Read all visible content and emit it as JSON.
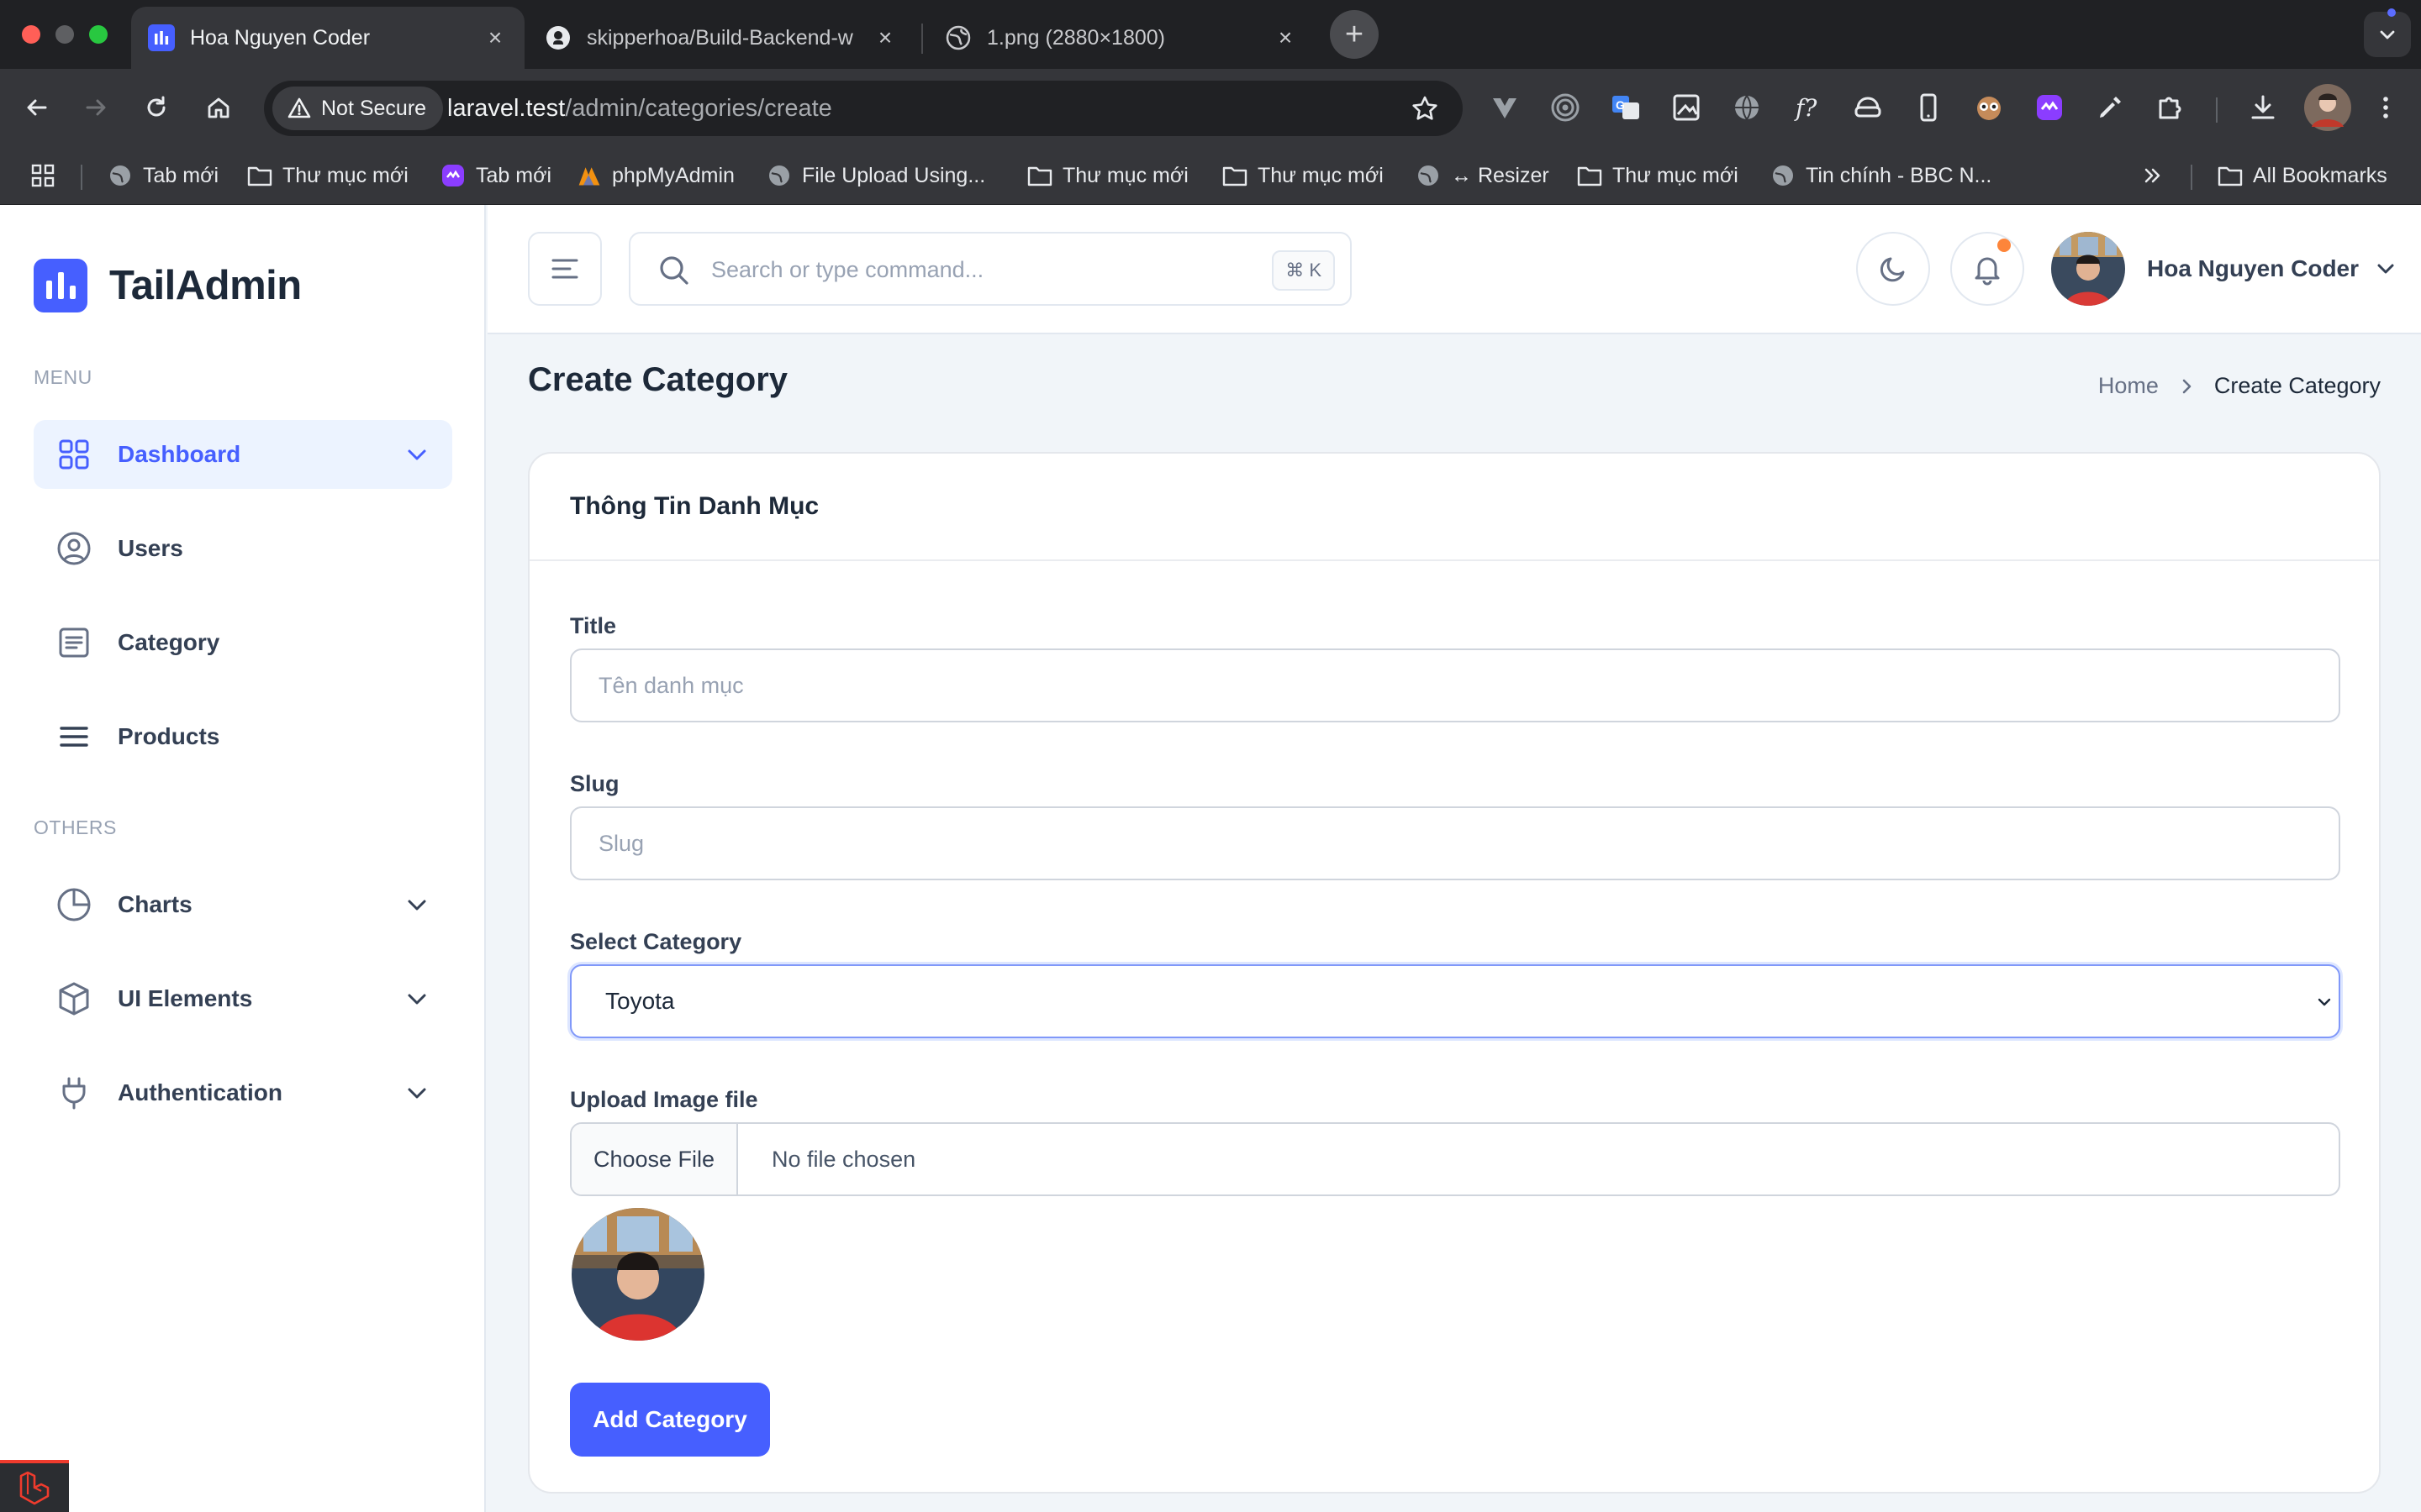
{
  "browser": {
    "tabs": [
      {
        "title": "Hoa Nguyen Coder",
        "icon": "tailadmin-favicon",
        "active": true
      },
      {
        "title": "skipperhoa/Build-Backend-w",
        "icon": "github-icon",
        "active": false
      },
      {
        "title": "1.png (2880×1800)",
        "icon": "globe-icon",
        "active": false
      }
    ],
    "security_label": "Not Secure",
    "url_host": "laravel.test",
    "url_path": "/admin/categories/create",
    "bookmarks": [
      {
        "label": "Tab mới",
        "icon": "globe-icon"
      },
      {
        "label": "Thư mục mới",
        "icon": "folder-icon"
      },
      {
        "label": "Tab mới",
        "icon": "purple-app-icon"
      },
      {
        "label": "phpMyAdmin",
        "icon": "phpmyadmin-icon"
      },
      {
        "label": "File Upload Using...",
        "icon": "globe-icon"
      },
      {
        "label": "Thư mục mới",
        "icon": "folder-icon"
      },
      {
        "label": "Thư mục mới",
        "icon": "folder-icon"
      },
      {
        "label": "↔ Resizer",
        "icon": "globe-icon"
      },
      {
        "label": "Thư mục mới",
        "icon": "folder-icon"
      },
      {
        "label": "Tin chính - BBC N...",
        "icon": "globe-icon"
      }
    ],
    "all_bookmarks_label": "All Bookmarks"
  },
  "sidebar": {
    "brand": "TailAdmin",
    "menu_heading": "MENU",
    "menu_items": [
      {
        "label": "Dashboard",
        "icon": "grid-icon",
        "active": true,
        "has_children": true
      },
      {
        "label": "Users",
        "icon": "user-circle-icon",
        "active": false,
        "has_children": false
      },
      {
        "label": "Category",
        "icon": "list-icon",
        "active": false,
        "has_children": false
      },
      {
        "label": "Products",
        "icon": "bars-icon",
        "active": false,
        "has_children": false
      }
    ],
    "others_heading": "OTHERS",
    "other_items": [
      {
        "label": "Charts",
        "icon": "pie-chart-icon",
        "has_children": true
      },
      {
        "label": "UI Elements",
        "icon": "box-icon",
        "has_children": true
      },
      {
        "label": "Authentication",
        "icon": "plug-icon",
        "has_children": true
      }
    ]
  },
  "header": {
    "search_placeholder": "Search or type command...",
    "search_shortcut": "⌘ K",
    "user_name": "Hoa Nguyen Coder"
  },
  "page": {
    "title": "Create Category",
    "breadcrumb_home": "Home",
    "breadcrumb_current": "Create Category"
  },
  "form": {
    "card_title": "Thông Tin Danh Mục",
    "title_label": "Title",
    "title_placeholder": "Tên danh mục",
    "slug_label": "Slug",
    "slug_placeholder": "Slug",
    "select_label": "Select Category",
    "select_value": "Toyota",
    "upload_label": "Upload Image file",
    "choose_file_label": "Choose File",
    "file_status": "No file chosen",
    "submit_label": "Add Category"
  },
  "colors": {
    "brand": "#465fff",
    "active_bg": "#ecf3ff",
    "notification": "#fd853a",
    "chrome_dark": "#202124",
    "chrome_toolbar": "#35363a"
  }
}
